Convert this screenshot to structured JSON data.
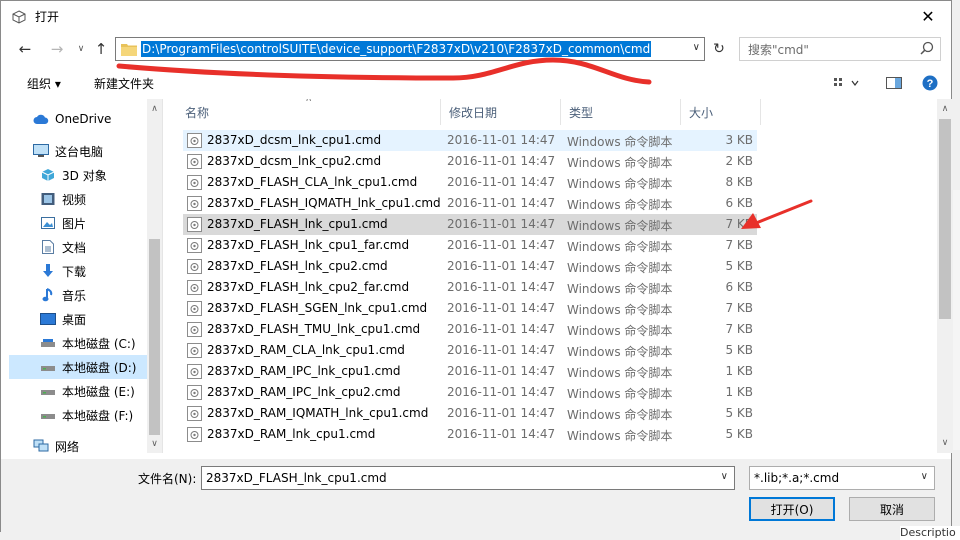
{
  "window": {
    "title": "打开"
  },
  "nav": {
    "address_path": "D:\\ProgramFiles\\controlSUITE\\device_support\\F2837xD\\v210\\F2837xD_common\\cmd",
    "search_placeholder": "搜索\"cmd\""
  },
  "toolbar": {
    "organize_label": "组织 ▾",
    "new_folder_label": "新建文件夹"
  },
  "sidebar": {
    "items": [
      {
        "label": "OneDrive",
        "icon": "cloud-icon"
      },
      {
        "label": "这台电脑",
        "icon": "computer-icon"
      },
      {
        "label": "3D 对象",
        "icon": "cube-icon"
      },
      {
        "label": "视频",
        "icon": "video-icon"
      },
      {
        "label": "图片",
        "icon": "picture-icon"
      },
      {
        "label": "文档",
        "icon": "document-icon"
      },
      {
        "label": "下载",
        "icon": "download-icon"
      },
      {
        "label": "音乐",
        "icon": "music-icon"
      },
      {
        "label": "桌面",
        "icon": "desktop-icon"
      },
      {
        "label": "本地磁盘 (C:)",
        "icon": "drive-icon"
      },
      {
        "label": "本地磁盘 (D:)",
        "icon": "drive-icon"
      },
      {
        "label": "本地磁盘 (E:)",
        "icon": "drive-icon"
      },
      {
        "label": "本地磁盘 (F:)",
        "icon": "drive-icon"
      },
      {
        "label": "网络",
        "icon": "network-icon"
      }
    ]
  },
  "columns": {
    "name": "名称",
    "date": "修改日期",
    "type": "类型",
    "size": "大小"
  },
  "files": [
    {
      "name": "2837xD_dcsm_lnk_cpu1.cmd",
      "date": "2016-11-01 14:47",
      "type": "Windows 命令脚本",
      "size": "3 KB"
    },
    {
      "name": "2837xD_dcsm_lnk_cpu2.cmd",
      "date": "2016-11-01 14:47",
      "type": "Windows 命令脚本",
      "size": "2 KB"
    },
    {
      "name": "2837xD_FLASH_CLA_lnk_cpu1.cmd",
      "date": "2016-11-01 14:47",
      "type": "Windows 命令脚本",
      "size": "8 KB"
    },
    {
      "name": "2837xD_FLASH_IQMATH_lnk_cpu1.cmd",
      "date": "2016-11-01 14:47",
      "type": "Windows 命令脚本",
      "size": "6 KB"
    },
    {
      "name": "2837xD_FLASH_lnk_cpu1.cmd",
      "date": "2016-11-01 14:47",
      "type": "Windows 命令脚本",
      "size": "7 KB"
    },
    {
      "name": "2837xD_FLASH_lnk_cpu1_far.cmd",
      "date": "2016-11-01 14:47",
      "type": "Windows 命令脚本",
      "size": "7 KB"
    },
    {
      "name": "2837xD_FLASH_lnk_cpu2.cmd",
      "date": "2016-11-01 14:47",
      "type": "Windows 命令脚本",
      "size": "5 KB"
    },
    {
      "name": "2837xD_FLASH_lnk_cpu2_far.cmd",
      "date": "2016-11-01 14:47",
      "type": "Windows 命令脚本",
      "size": "6 KB"
    },
    {
      "name": "2837xD_FLASH_SGEN_lnk_cpu1.cmd",
      "date": "2016-11-01 14:47",
      "type": "Windows 命令脚本",
      "size": "7 KB"
    },
    {
      "name": "2837xD_FLASH_TMU_lnk_cpu1.cmd",
      "date": "2016-11-01 14:47",
      "type": "Windows 命令脚本",
      "size": "7 KB"
    },
    {
      "name": "2837xD_RAM_CLA_lnk_cpu1.cmd",
      "date": "2016-11-01 14:47",
      "type": "Windows 命令脚本",
      "size": "5 KB"
    },
    {
      "name": "2837xD_RAM_IPC_lnk_cpu1.cmd",
      "date": "2016-11-01 14:47",
      "type": "Windows 命令脚本",
      "size": "1 KB"
    },
    {
      "name": "2837xD_RAM_IPC_lnk_cpu2.cmd",
      "date": "2016-11-01 14:47",
      "type": "Windows 命令脚本",
      "size": "1 KB"
    },
    {
      "name": "2837xD_RAM_IQMATH_lnk_cpu1.cmd",
      "date": "2016-11-01 14:47",
      "type": "Windows 命令脚本",
      "size": "5 KB"
    },
    {
      "name": "2837xD_RAM_lnk_cpu1.cmd",
      "date": "2016-11-01 14:47",
      "type": "Windows 命令脚本",
      "size": "5 KB"
    }
  ],
  "bottom": {
    "filename_label": "文件名(N):",
    "filename_value": "2837xD_FLASH_lnk_cpu1.cmd",
    "filter_value": "*.lib;*.a;*.cmd",
    "open_label": "打开(O)",
    "cancel_label": "取消"
  },
  "background": {
    "partial_text": "Descriptio"
  },
  "colors": {
    "selection": "#cce8ff",
    "address_highlight": "#0078d7",
    "annotation": "#e8302a"
  }
}
